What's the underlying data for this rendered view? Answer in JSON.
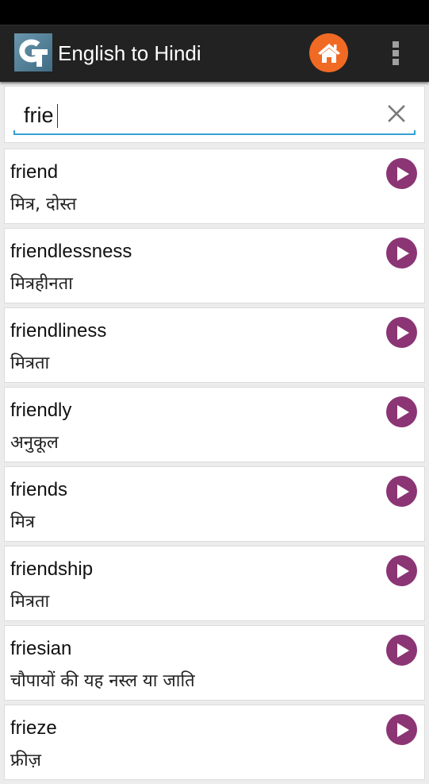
{
  "header": {
    "title": "English to Hindi",
    "logo_icon": "app-logo-icon",
    "home_icon": "home-icon",
    "menu_icon": "overflow-menu-icon"
  },
  "colors": {
    "action_bar": "#222222",
    "home_button": "#f06a24",
    "play_button": "#8b3575",
    "search_underline": "#33a0d0"
  },
  "search": {
    "value": "frie",
    "placeholder": "",
    "clear_icon": "clear-icon"
  },
  "results": [
    {
      "word": "friend",
      "meaning": "मित्र, दोस्त"
    },
    {
      "word": "friendlessness",
      "meaning": "मित्रहीनता"
    },
    {
      "word": "friendliness",
      "meaning": "मित्रता"
    },
    {
      "word": "friendly",
      "meaning": "अनुकूल"
    },
    {
      "word": "friends",
      "meaning": "मित्र"
    },
    {
      "word": "friendship",
      "meaning": "मित्रता"
    },
    {
      "word": "friesian",
      "meaning": "चौपायों की यह नस्ल या जाति"
    },
    {
      "word": "frieze",
      "meaning": "फ्रीज़"
    }
  ]
}
